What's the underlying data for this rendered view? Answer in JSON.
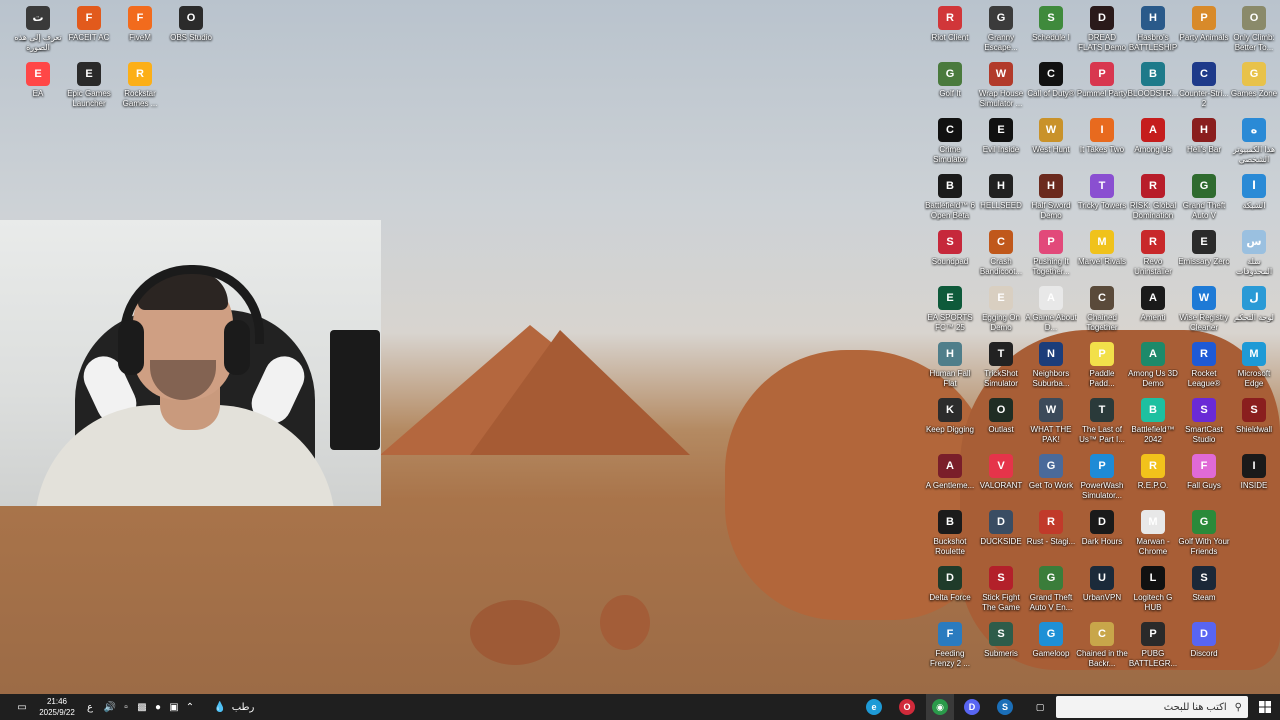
{
  "desktop_left": [
    {
      "label": "تعرف إلى هذه الصورة",
      "icon": "camera-icon",
      "color": "#3a3a3a"
    },
    {
      "label": "FACEIT AC",
      "icon": "faceit-icon",
      "color": "#e25a1c"
    },
    {
      "label": "FiveM",
      "icon": "fivem-icon",
      "color": "#f26b1d"
    },
    {
      "label": "OBS Studio",
      "icon": "obs-icon",
      "color": "#2b2b2b"
    },
    {
      "label": "EA",
      "icon": "ea-icon",
      "color": "#ff4747"
    },
    {
      "label": "Epic Games Launcher",
      "icon": "epic-icon",
      "color": "#2a2a2a"
    },
    {
      "label": "Rockstar Games ...",
      "icon": "rockstar-icon",
      "color": "#fcaf17"
    }
  ],
  "desktop_right_columns": [
    [
      {
        "label": "Riot Client",
        "icon": "riot-icon",
        "color": "#d13639"
      },
      {
        "label": "Golf It",
        "icon": "golf-it-icon",
        "color": "#4a7a3d"
      },
      {
        "label": "Crime Simulator",
        "icon": "crime-simulator-icon",
        "color": "#111111"
      },
      {
        "label": "Battlefield™ 6 Open Beta",
        "icon": "battlefield-icon",
        "color": "#1a1a1a"
      },
      {
        "label": "Soundpad",
        "icon": "soundpad-icon",
        "color": "#c6283b"
      },
      {
        "label": "EA SPORTS FC™ 25",
        "icon": "fc25-icon",
        "color": "#0e5a3a"
      },
      {
        "label": "Human Fall Flat",
        "icon": "human-fall-flat-icon",
        "color": "#4f7e8a"
      },
      {
        "label": "Keep Digging",
        "icon": "keep-digging-icon",
        "color": "#2c2c2c"
      },
      {
        "label": "A Gentleme...",
        "icon": "gentleman-icon",
        "color": "#7a1e2a"
      },
      {
        "label": "Buckshot Roulette",
        "icon": "buckshot-icon",
        "color": "#1b1b1b"
      },
      {
        "label": "Delta Force",
        "icon": "delta-force-icon",
        "color": "#1f3b2a"
      },
      {
        "label": "Feeding Frenzy 2 ...",
        "icon": "feeding-frenzy-icon",
        "color": "#2a7bbf"
      }
    ],
    [
      {
        "label": "Granny Escape...",
        "icon": "granny-icon",
        "color": "#3b3b3b"
      },
      {
        "label": "Wrap House Simulator ...",
        "icon": "wrap-house-icon",
        "color": "#b23a2a"
      },
      {
        "label": "Evil Inside",
        "icon": "evil-inside-icon",
        "color": "#111111"
      },
      {
        "label": "HELLSEED",
        "icon": "hellseed-icon",
        "color": "#222222"
      },
      {
        "label": "Crash Bandicoot...",
        "icon": "crash-icon",
        "color": "#c0581b"
      },
      {
        "label": "Egging On Demo",
        "icon": "egging-on-icon",
        "color": "#d9cfc1"
      },
      {
        "label": "TrickShot Simulator",
        "icon": "trickshot-icon",
        "color": "#222222"
      },
      {
        "label": "Outlast",
        "icon": "outlast-icon",
        "color": "#1f2d24"
      },
      {
        "label": "VALORANT",
        "icon": "valorant-icon",
        "color": "#e5344a"
      },
      {
        "label": "DUCKSIDE",
        "icon": "duckside-icon",
        "color": "#3a4d63"
      },
      {
        "label": "Stick Fight The Game",
        "icon": "stick-fight-icon",
        "color": "#b3202a"
      },
      {
        "label": "Submeris",
        "icon": "submeris-icon",
        "color": "#2e5c4a"
      }
    ],
    [
      {
        "label": "Schedule I",
        "icon": "schedule-icon",
        "color": "#3f8a3c"
      },
      {
        "label": "Call of Duty®",
        "icon": "cod-icon",
        "color": "#111111"
      },
      {
        "label": "West Hunt",
        "icon": "west-hunt-icon",
        "color": "#c9922a"
      },
      {
        "label": "Half Sword Demo",
        "icon": "half-sword-icon",
        "color": "#6b2a1e"
      },
      {
        "label": "Pushing It Together...",
        "icon": "pushing-it-icon",
        "color": "#e2497a"
      },
      {
        "label": "A Game About D...",
        "icon": "game-about-icon",
        "color": "#e8e8e8"
      },
      {
        "label": "Neighbors Suburba...",
        "icon": "neighbors-icon",
        "color": "#1c3d7a"
      },
      {
        "label": "WHAT THE PAK!",
        "icon": "what-the-pak-icon",
        "color": "#3c4a5a"
      },
      {
        "label": "Get To Work",
        "icon": "get-to-work-icon",
        "color": "#4a6a9a"
      },
      {
        "label": "Rust - Stagi...",
        "icon": "rust-icon",
        "color": "#c13a2a"
      },
      {
        "label": "Grand Theft Auto V En...",
        "icon": "gta-v-icon",
        "color": "#3a7d3a"
      },
      {
        "label": "Gameloop",
        "icon": "gameloop-icon",
        "color": "#1e90d6"
      }
    ],
    [
      {
        "label": "DREAD FLATS Demo",
        "icon": "dread-flats-icon",
        "color": "#2a1a1a"
      },
      {
        "label": "Pummel Party",
        "icon": "pummel-party-icon",
        "color": "#d8374f"
      },
      {
        "label": "It Takes Two",
        "icon": "it-takes-two-icon",
        "color": "#e86a1e"
      },
      {
        "label": "Tricky Towers",
        "icon": "tricky-towers-icon",
        "color": "#8a4fd1"
      },
      {
        "label": "Marvel Rivals",
        "icon": "marvel-rivals-icon",
        "color": "#f0c21b"
      },
      {
        "label": "Chained Together",
        "icon": "chained-together-icon",
        "color": "#5a4a3a"
      },
      {
        "label": "Paddle Padd...",
        "icon": "paddle-icon",
        "color": "#f2e04a"
      },
      {
        "label": "The Last of Us™ Part I...",
        "icon": "last-of-us-icon",
        "color": "#2a3a3a"
      },
      {
        "label": "PowerWash Simulator...",
        "icon": "powerwash-icon",
        "color": "#1e8bd6"
      },
      {
        "label": "Dark Hours",
        "icon": "dark-hours-icon",
        "color": "#1a1a1a"
      },
      {
        "label": "UrbanVPN",
        "icon": "urbanvpn-icon",
        "color": "#1b2a3a"
      },
      {
        "label": "Chained in the Backr...",
        "icon": "chained-backrooms-icon",
        "color": "#c8a64a"
      }
    ],
    [
      {
        "label": "Hasbro's BATTLESHIP",
        "icon": "battleship-icon",
        "color": "#2a5a8a"
      },
      {
        "label": "BLOODSTR...",
        "icon": "bloodstrike-icon",
        "color": "#1e7a8a"
      },
      {
        "label": "Among Us",
        "icon": "among-us-icon",
        "color": "#c51d1d"
      },
      {
        "label": "RISK: Global Domination",
        "icon": "risk-icon",
        "color": "#b81d2a"
      },
      {
        "label": "Revo Uninstaller",
        "icon": "revo-icon",
        "color": "#c8282a"
      },
      {
        "label": "Amenti",
        "icon": "amenti-icon",
        "color": "#1a1a1a"
      },
      {
        "label": "Among Us 3D Demo",
        "icon": "among-us-3d-icon",
        "color": "#1d8a6a"
      },
      {
        "label": "Battlefield™ 2042",
        "icon": "bf2042-icon",
        "color": "#1ec0a0"
      },
      {
        "label": "R.E.P.O.",
        "icon": "repo-icon",
        "color": "#f2c21b"
      },
      {
        "label": "Marwan - Chrome",
        "icon": "chrome-icon",
        "color": "#e8e8e8"
      },
      {
        "label": "Logitech G HUB",
        "icon": "logitech-icon",
        "color": "#111111"
      },
      {
        "label": "PUBG BATTLEGR...",
        "icon": "pubg-icon",
        "color": "#2a2a2a"
      }
    ],
    [
      {
        "label": "Party Animals",
        "icon": "party-animals-icon",
        "color": "#d88a2a"
      },
      {
        "label": "Counter-Stri... 2",
        "icon": "cs2-icon",
        "color": "#1e3a8a"
      },
      {
        "label": "Hell's Bar",
        "icon": "hells-bar-icon",
        "color": "#8a1e1e"
      },
      {
        "label": "Grand Theft Auto V",
        "icon": "gta-v-legacy-icon",
        "color": "#2f6b2f"
      },
      {
        "label": "Emissary Zero",
        "icon": "emissary-icon",
        "color": "#2a2a2a"
      },
      {
        "label": "Wise Registry Cleaner",
        "icon": "wise-registry-icon",
        "color": "#1e7ad6"
      },
      {
        "label": "Rocket League®",
        "icon": "rocket-league-icon",
        "color": "#1e5ad6"
      },
      {
        "label": "SmartCast Studio",
        "icon": "smartcast-icon",
        "color": "#6a2ad6"
      },
      {
        "label": "Fall Guys",
        "icon": "fall-guys-icon",
        "color": "#e06ad6"
      },
      {
        "label": "Golf With Your Friends",
        "icon": "golf-friends-icon",
        "color": "#2a8a3a"
      },
      {
        "label": "Steam",
        "icon": "steam-icon",
        "color": "#1b2838"
      },
      {
        "label": "Discord",
        "icon": "discord-icon",
        "color": "#5865f2"
      }
    ],
    [
      {
        "label": "Only Climb: Better To...",
        "icon": "only-climb-icon",
        "color": "#8a8a6a"
      },
      {
        "label": "Games Zone",
        "icon": "games-zone-icon",
        "color": "#e8c24a"
      },
      {
        "label": "هذا الكمبيوتر الشخصي",
        "icon": "this-pc-icon",
        "color": "#2a8ad6"
      },
      {
        "label": "الشبكة",
        "icon": "network-icon",
        "color": "#2a8ad6"
      },
      {
        "label": "سلة المحذوفات",
        "icon": "recycle-bin-icon",
        "color": "#9ac0e0"
      },
      {
        "label": "لوحة التحكم",
        "icon": "control-panel-icon",
        "color": "#2a9ad6"
      },
      {
        "label": "Microsoft Edge",
        "icon": "edge-icon",
        "color": "#1e9ad6"
      },
      {
        "label": "Shieldwall",
        "icon": "shieldwall-icon",
        "color": "#8a1e1e"
      },
      {
        "label": "INSIDE",
        "icon": "inside-icon",
        "color": "#1a1a1a"
      },
      {
        "label": "",
        "icon": "",
        "color": ""
      },
      {
        "label": "",
        "icon": "",
        "color": ""
      },
      {
        "label": "",
        "icon": "",
        "color": ""
      }
    ]
  ],
  "taskbar": {
    "search_placeholder": "اكتب هنا للبحث",
    "time": "21:46",
    "date": "2025/9/22",
    "weather_label": "رطب",
    "lang": "ع",
    "apps": [
      {
        "name": "edge",
        "color": "#1e9ad6",
        "glyph": "e"
      },
      {
        "name": "opera-gx",
        "color": "#d02a3a",
        "glyph": "O"
      },
      {
        "name": "chrome",
        "color": "#2a9a4a",
        "glyph": "◉"
      },
      {
        "name": "discord",
        "color": "#5865f2",
        "glyph": "D"
      },
      {
        "name": "steam",
        "color": "#1b6fb8",
        "glyph": "S"
      }
    ]
  }
}
